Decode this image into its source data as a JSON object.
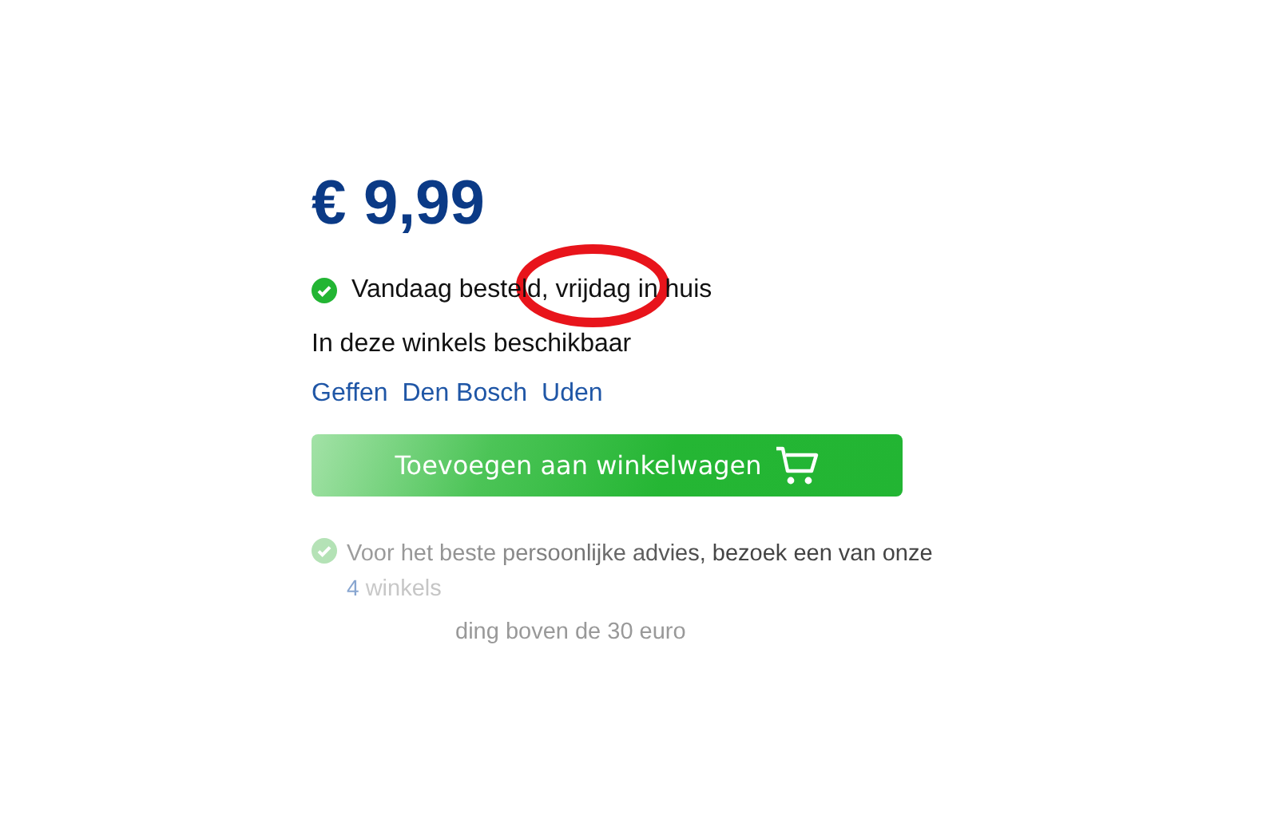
{
  "price": "€ 9,99",
  "delivery": {
    "text": "Vandaag besteld, vrijdag in huis"
  },
  "stores_label": "In deze winkels beschikbaar",
  "stores": [
    "Geffen",
    "Den Bosch",
    "Uden"
  ],
  "cart_button": {
    "label": "Toevoegen aan winkelwagen"
  },
  "usps": [
    {
      "text": "Voor het beste persoonlijke advies, bezoek een van onze",
      "link": "4",
      "after": "winkels",
      "icon": true
    },
    {
      "text": "ding boven de 30 euro",
      "icon": false
    }
  ]
}
